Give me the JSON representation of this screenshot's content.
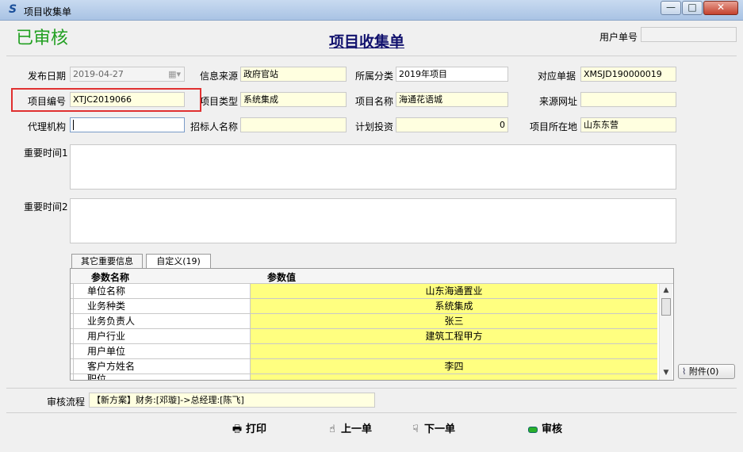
{
  "window": {
    "title": "项目收集单",
    "min": "—",
    "max": "□",
    "close": "✕"
  },
  "status_stamp": "已审核",
  "form_title": "项目收集单",
  "user_no": {
    "label": "用户单号",
    "value": ""
  },
  "fields": {
    "publish_date": {
      "label": "发布日期",
      "value": "2019-04-27"
    },
    "info_source": {
      "label": "信息来源",
      "value": "政府官站"
    },
    "category": {
      "label": "所属分类",
      "value": "2019年项目"
    },
    "ref_doc": {
      "label": "对应单据",
      "value": "XMSJD190000019"
    },
    "project_no": {
      "label": "项目编号",
      "value": "XTJC2019066"
    },
    "project_type": {
      "label": "项目类型",
      "value": "系统集成"
    },
    "project_name": {
      "label": "项目名称",
      "value": "海通花语城"
    },
    "source_url": {
      "label": "来源网址",
      "value": ""
    },
    "agency": {
      "label": "代理机构",
      "value": ""
    },
    "tenderer": {
      "label": "招标人名称",
      "value": ""
    },
    "planned_invest": {
      "label": "计划投资",
      "value": "0"
    },
    "location": {
      "label": "项目所在地",
      "value": "山东东营"
    },
    "key_time1": {
      "label": "重要时间1",
      "value": ""
    },
    "key_time2": {
      "label": "重要时间2",
      "value": ""
    }
  },
  "tabs": [
    {
      "label": "其它重要信息",
      "active": false
    },
    {
      "label": "自定义(19)",
      "active": true
    }
  ],
  "grid": {
    "columns": [
      "参数名称",
      "参数值"
    ],
    "rows": [
      {
        "name": "单位名称",
        "value": "山东海通置业"
      },
      {
        "name": "业务种类",
        "value": "系统集成"
      },
      {
        "name": "业务负责人",
        "value": "张三"
      },
      {
        "name": "用户行业",
        "value": "建筑工程甲方"
      },
      {
        "name": "用户单位",
        "value": ""
      },
      {
        "name": "客户方姓名",
        "value": "李四"
      },
      {
        "name": "职位",
        "value": ""
      }
    ]
  },
  "attachment": {
    "label": "附件(0)",
    "icon": "paperclip-icon"
  },
  "workflow": {
    "label": "审核流程",
    "value": "【新方案】财务:[邓璇]->总经理:[陈飞]"
  },
  "buttons": {
    "print": "打印",
    "prev": "上一单",
    "next": "下一单",
    "audit": "审核"
  },
  "colors": {
    "stamp": "#22a022",
    "title": "#12126e",
    "field_bg": "#ffffe0",
    "grid_value_bg": "#ffff80",
    "highlight": "#e03030"
  }
}
